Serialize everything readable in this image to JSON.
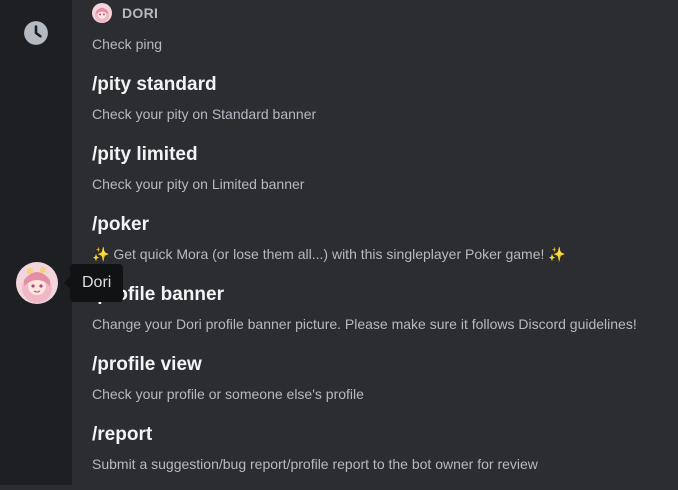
{
  "sidebar": {
    "recent_icon": "clock-icon",
    "app_avatar": "dori-avatar",
    "tooltip": "Dori"
  },
  "app": {
    "name": "DORI",
    "first_description": "Check ping"
  },
  "commands": [
    {
      "name": "/pity standard",
      "description": "Check your pity on Standard banner"
    },
    {
      "name": "/pity limited",
      "description": "Check your pity on Limited banner"
    },
    {
      "name": "/poker",
      "description": "Get quick Mora (or lose them all...) with this singleplayer Poker game!"
    },
    {
      "name": "/profile banner",
      "description": "Change your Dori profile banner picture. Please make sure it follows Discord guidelines!"
    },
    {
      "name": "/profile view",
      "description": "Check your profile or someone else's profile"
    },
    {
      "name": "/report",
      "description": "Submit a suggestion/bug report/profile report to the bot owner for review"
    }
  ],
  "icons": {
    "sparkles": "✨"
  },
  "colors": {
    "rail_bg": "#1e1f22",
    "panel_bg": "#2b2d31",
    "tooltip_bg": "#111214",
    "title_text": "#f2f3f5",
    "desc_text": "#b5bac1"
  }
}
